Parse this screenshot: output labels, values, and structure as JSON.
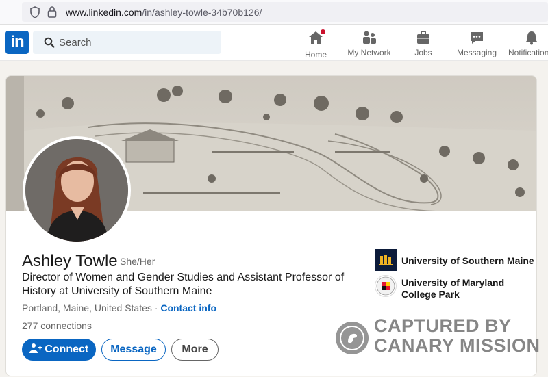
{
  "browser": {
    "url_domain": "www.linkedin.com",
    "url_path": "/in/ashley-towle-34b70b126/"
  },
  "header": {
    "logo": "in",
    "search_placeholder": "Search",
    "nav": [
      {
        "label": "Home",
        "icon": "home-icon"
      },
      {
        "label": "My Network",
        "icon": "network-icon"
      },
      {
        "label": "Jobs",
        "icon": "briefcase-icon"
      },
      {
        "label": "Messaging",
        "icon": "messaging-icon"
      },
      {
        "label": "Notifications",
        "icon": "bell-icon"
      }
    ],
    "brand_color": "#0a66c2"
  },
  "profile": {
    "name": "Ashley Towle",
    "pronouns": "She/Her",
    "headline": "Director of Women and Gender Studies and Assistant Professor of History at University of Southern Maine",
    "location": "Portland, Maine, United States",
    "separator": "·",
    "contact_info": "Contact info",
    "connections": "277 connections",
    "buttons": {
      "connect": "Connect",
      "message": "Message",
      "more": "More"
    },
    "education": [
      {
        "name": "University of Southern Maine"
      },
      {
        "name_line1": "University of Maryland",
        "name_line2": "College Park"
      }
    ]
  },
  "watermark": {
    "line1": "CAPTURED BY",
    "line2": "CANARY MISSION"
  }
}
